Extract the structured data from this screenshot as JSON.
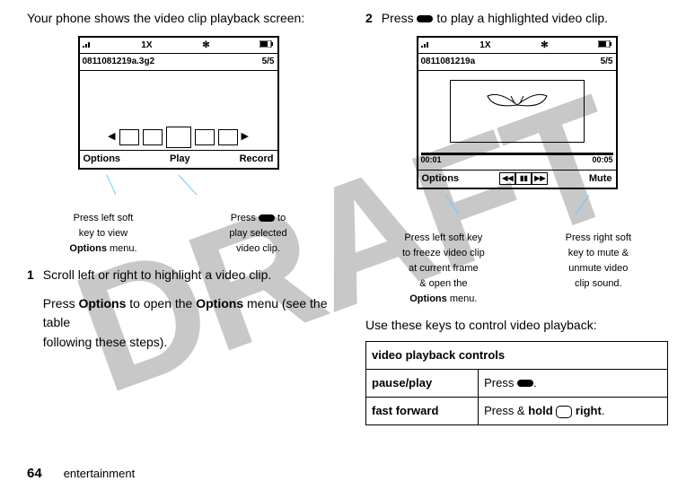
{
  "watermark": "DRAFT",
  "left": {
    "intro": "Your phone shows the video clip playback screen:",
    "phone": {
      "net": "1X",
      "file": "0811081219a.3g2",
      "counter": "5/5",
      "soft": {
        "left": "Options",
        "center": "Play",
        "right": "Record"
      }
    },
    "captions": {
      "c1": {
        "l1": "Press left soft",
        "l2": "key to view",
        "l3": "Options",
        "l4": "menu."
      },
      "c2": {
        "l1": "Press",
        "l1b": "to",
        "l2": "play selected",
        "l3": "video clip."
      }
    },
    "step1": {
      "num": "1",
      "l1": "Scroll left or right to highlight a video clip.",
      "l2a": "Press ",
      "options1": "Options",
      "l2b": " to open the ",
      "options2": "Options",
      "l2c": " menu (see the table",
      "l3": "following these steps)."
    }
  },
  "right": {
    "step2": {
      "num": "2",
      "a": "Press ",
      "b": " to play a highlighted video clip."
    },
    "phone": {
      "net": "1X",
      "file": "0811081219a",
      "counter": "5/5",
      "t1": "00:01",
      "t2": "00:05",
      "soft": {
        "left": "Options",
        "right": "Mute"
      }
    },
    "captions": {
      "c1": {
        "l1": "Press left soft key",
        "l2": "to freeze video clip",
        "l3": "at current frame",
        "l4": "& open the",
        "l5": "Options",
        "l6": "menu."
      },
      "c2": {
        "l1": "Press right soft",
        "l2": "key to mute &",
        "l3": "unmute video",
        "l4": "clip sound."
      }
    },
    "controls_intro": "Use these keys to control video playback:",
    "table": {
      "header": "video playback controls",
      "r1": {
        "label": "pause/play",
        "a": "Press",
        "b": "."
      },
      "r2": {
        "label": "fast forward",
        "a": "Press &",
        "b": "hold",
        "c": "right",
        "d": "."
      }
    }
  },
  "footer": {
    "page": "64",
    "section": "entertainment"
  }
}
